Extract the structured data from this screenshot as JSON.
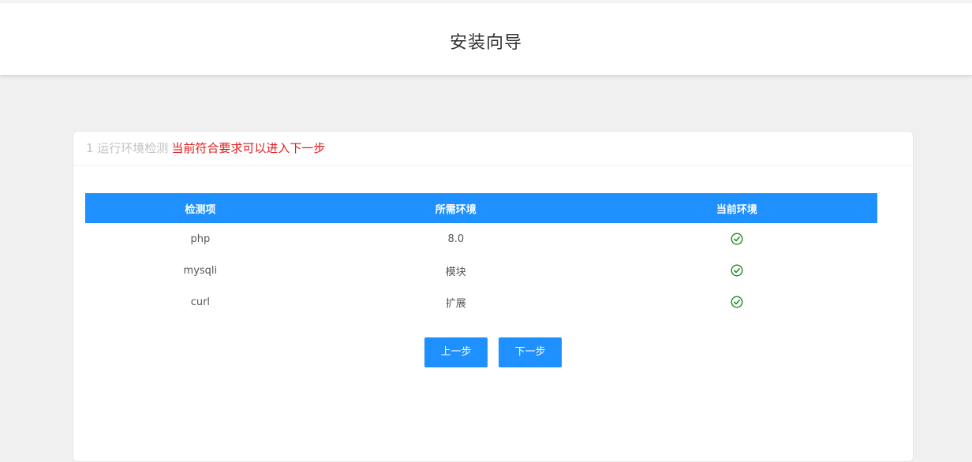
{
  "header": {
    "title": "安装向导"
  },
  "card": {
    "step_label": "1 运行环境检测",
    "status_message": "当前符合要求可以进入下一步"
  },
  "table": {
    "columns": [
      "检测项",
      "所需环境",
      "当前环境"
    ],
    "rows": [
      {
        "item": "php",
        "required": "8.0",
        "current": "check-circle-icon"
      },
      {
        "item": "mysqli",
        "required": "模块",
        "current": "check-circle-icon"
      },
      {
        "item": "curl",
        "required": "扩展",
        "current": "check-circle-icon"
      }
    ]
  },
  "buttons": {
    "prev_label": "上一步",
    "next_label": "下一步"
  },
  "colors": {
    "accent": "#1e90ff",
    "status_red": "#e01b1b",
    "check_green": "#1a8a1a",
    "muted": "#c2c2c2"
  }
}
